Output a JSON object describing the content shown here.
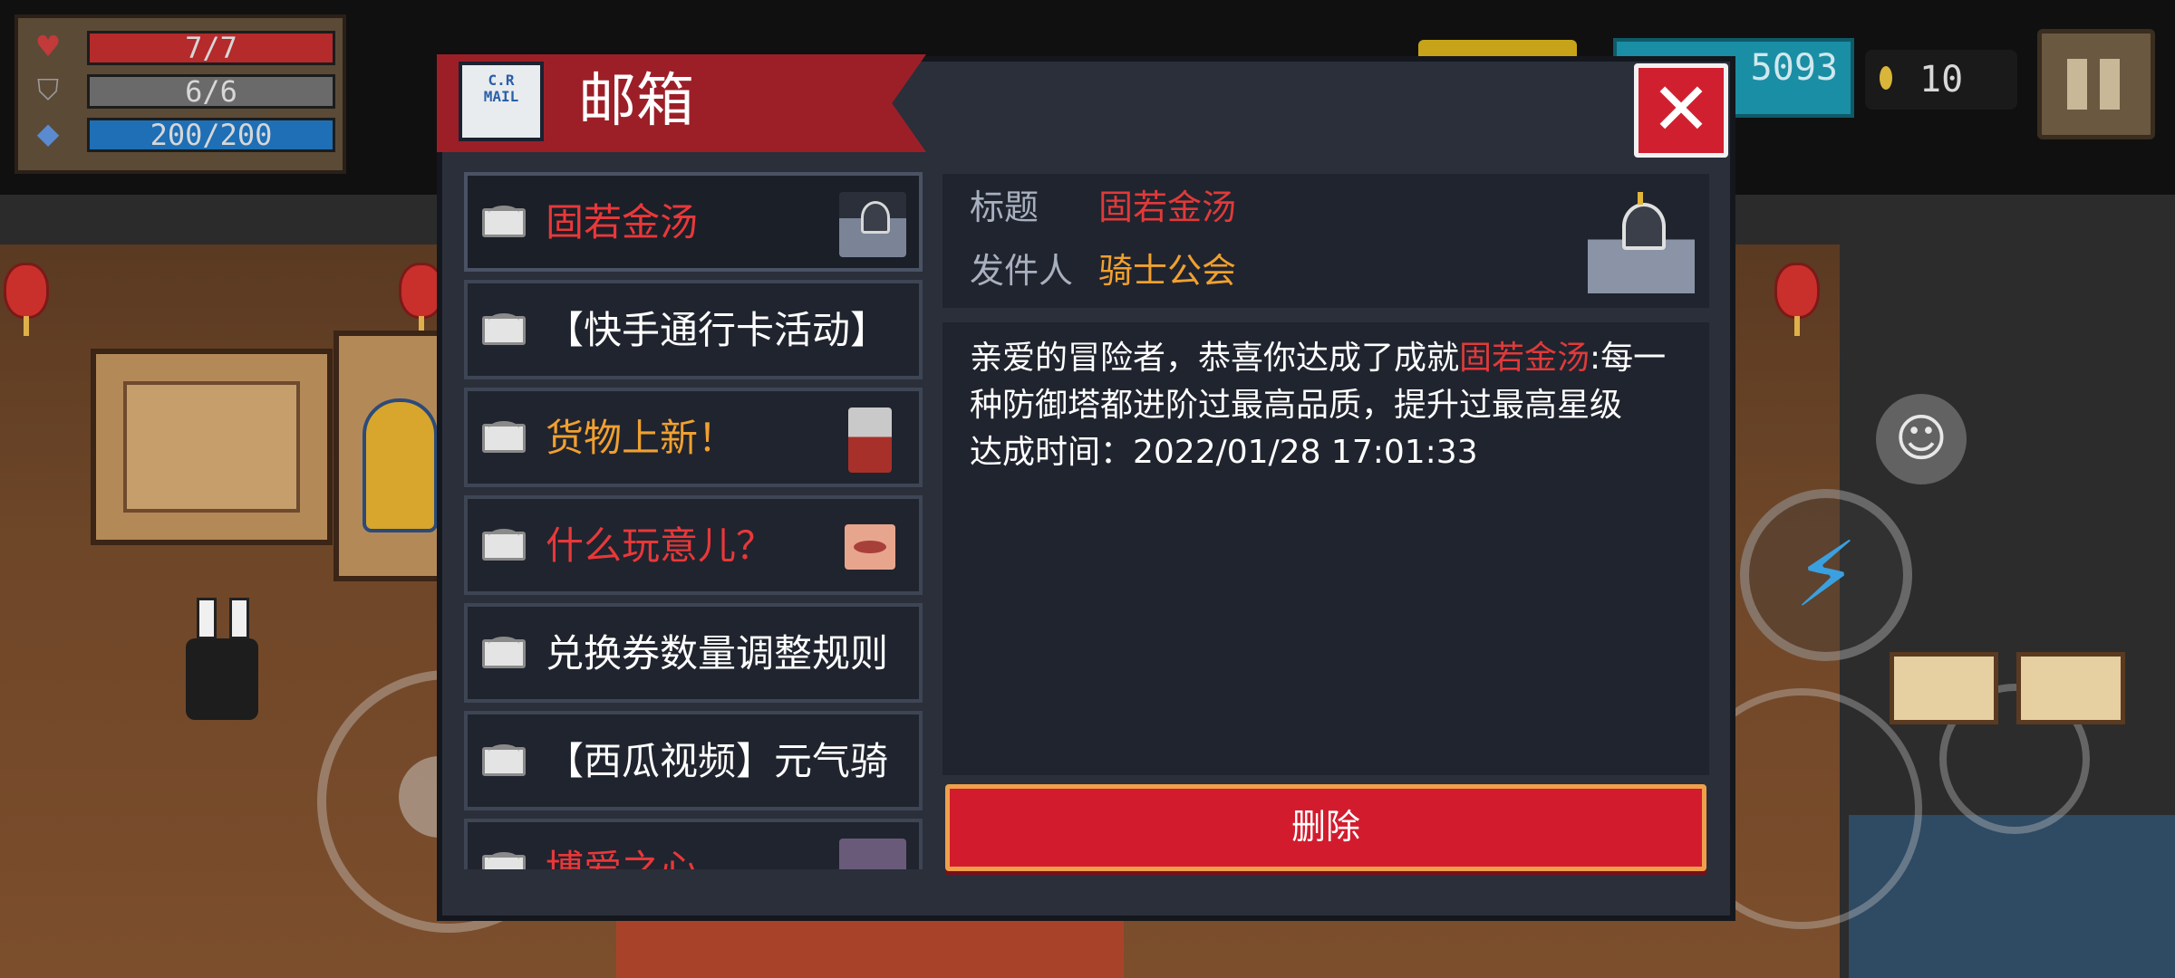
{
  "hud": {
    "hp": "7/7",
    "armor": "6/6",
    "energy": "200/200",
    "gems": "5093",
    "coins": "10"
  },
  "mailbox": {
    "title": "邮箱",
    "logo_text": "C.R MAIL",
    "close_label": "✕",
    "items": [
      {
        "label": "固若金汤",
        "color": "#e8383a",
        "thumb": "guild",
        "selected": true
      },
      {
        "label": "【快手通行卡活动】",
        "color": "#ffffff",
        "thumb": "none"
      },
      {
        "label": "货物上新！",
        "color": "#f0a030",
        "thumb": "merchant"
      },
      {
        "label": "什么玩意儿？",
        "color": "#e8383a",
        "thumb": "lips"
      },
      {
        "label": "兑换券数量调整规则",
        "color": "#ffffff",
        "thumb": "none"
      },
      {
        "label": "【西瓜视频】元气骑",
        "color": "#ffffff",
        "thumb": "none"
      },
      {
        "label": "博爱之心",
        "color": "#e8383a",
        "thumb": "char"
      }
    ],
    "detail": {
      "title_key": "标题",
      "title_value": "固若金汤",
      "sender_key": "发件人",
      "sender_value": "骑士公会",
      "body_prefix": "亲爱的冒险者，恭喜你达成了成就",
      "body_highlight": "固若金汤",
      "body_suffix": ":每一种防御塔都进阶过最高品质，提升过最高星级",
      "time_line": "达成时间：2022/01/28 17:01:33"
    },
    "delete_label": "删除"
  },
  "colors": {
    "accent_red": "#d21c2e",
    "highlight_red": "#e03a3a",
    "sender_orange": "#f0a030",
    "panel_bg": "#2a2f3a"
  }
}
